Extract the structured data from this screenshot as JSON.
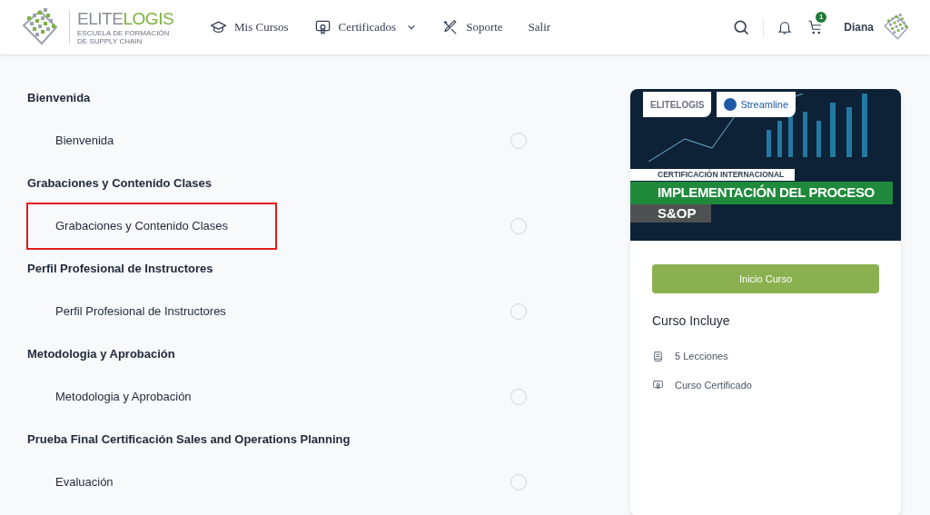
{
  "header": {
    "logo": {
      "part_1": "ELITE",
      "part_2": "LOGIS",
      "tagline": "ESCUELA DE FORMACIÓN DE SUPPLY CHAIN"
    },
    "nav": [
      {
        "label": "Mis Cursos",
        "dropdown": false
      },
      {
        "label": "Certificados",
        "dropdown": true
      },
      {
        "label": "Soporte",
        "dropdown": false
      },
      {
        "label": "Salir",
        "dropdown": false
      }
    ],
    "cart_count": "1",
    "user_name": "Diana"
  },
  "sections": [
    {
      "title": "Bienvenida",
      "lessons": [
        {
          "title": "Bienvenida",
          "completed": false,
          "highlighted": false
        }
      ]
    },
    {
      "title": "Grabaciones y Contenido Clases",
      "lessons": [
        {
          "title": "Grabaciones y Contenido Clases",
          "completed": false,
          "highlighted": true
        }
      ]
    },
    {
      "title": "Perfil Profesional de Instructores",
      "lessons": [
        {
          "title": "Perfil Profesional de Instructores",
          "completed": false,
          "highlighted": false
        }
      ]
    },
    {
      "title": "Metodologia y Aprobación",
      "lessons": [
        {
          "title": "Metodologia y Aprobación",
          "completed": false,
          "highlighted": false
        }
      ]
    },
    {
      "title": "Prueba Final Certificación Sales and Operations Planning",
      "lessons": [
        {
          "title": "Evaluación",
          "completed": false,
          "highlighted": false
        }
      ]
    }
  ],
  "course_card": {
    "banner": {
      "logo_text": "ELITELOGIS",
      "partner": "Streamline",
      "kicker": "CERTIFICACIÓN INTERNACIONAL",
      "headline": "IMPLEMENTACIÓN DEL PROCESO",
      "subhead": "S&OP"
    },
    "button": "Inicio Curso",
    "includes_title": "Curso Incluye",
    "includes": [
      {
        "kind": "lessons",
        "label": "5 Lecciones"
      },
      {
        "kind": "certificate",
        "label": "Curso Certificado"
      }
    ]
  }
}
